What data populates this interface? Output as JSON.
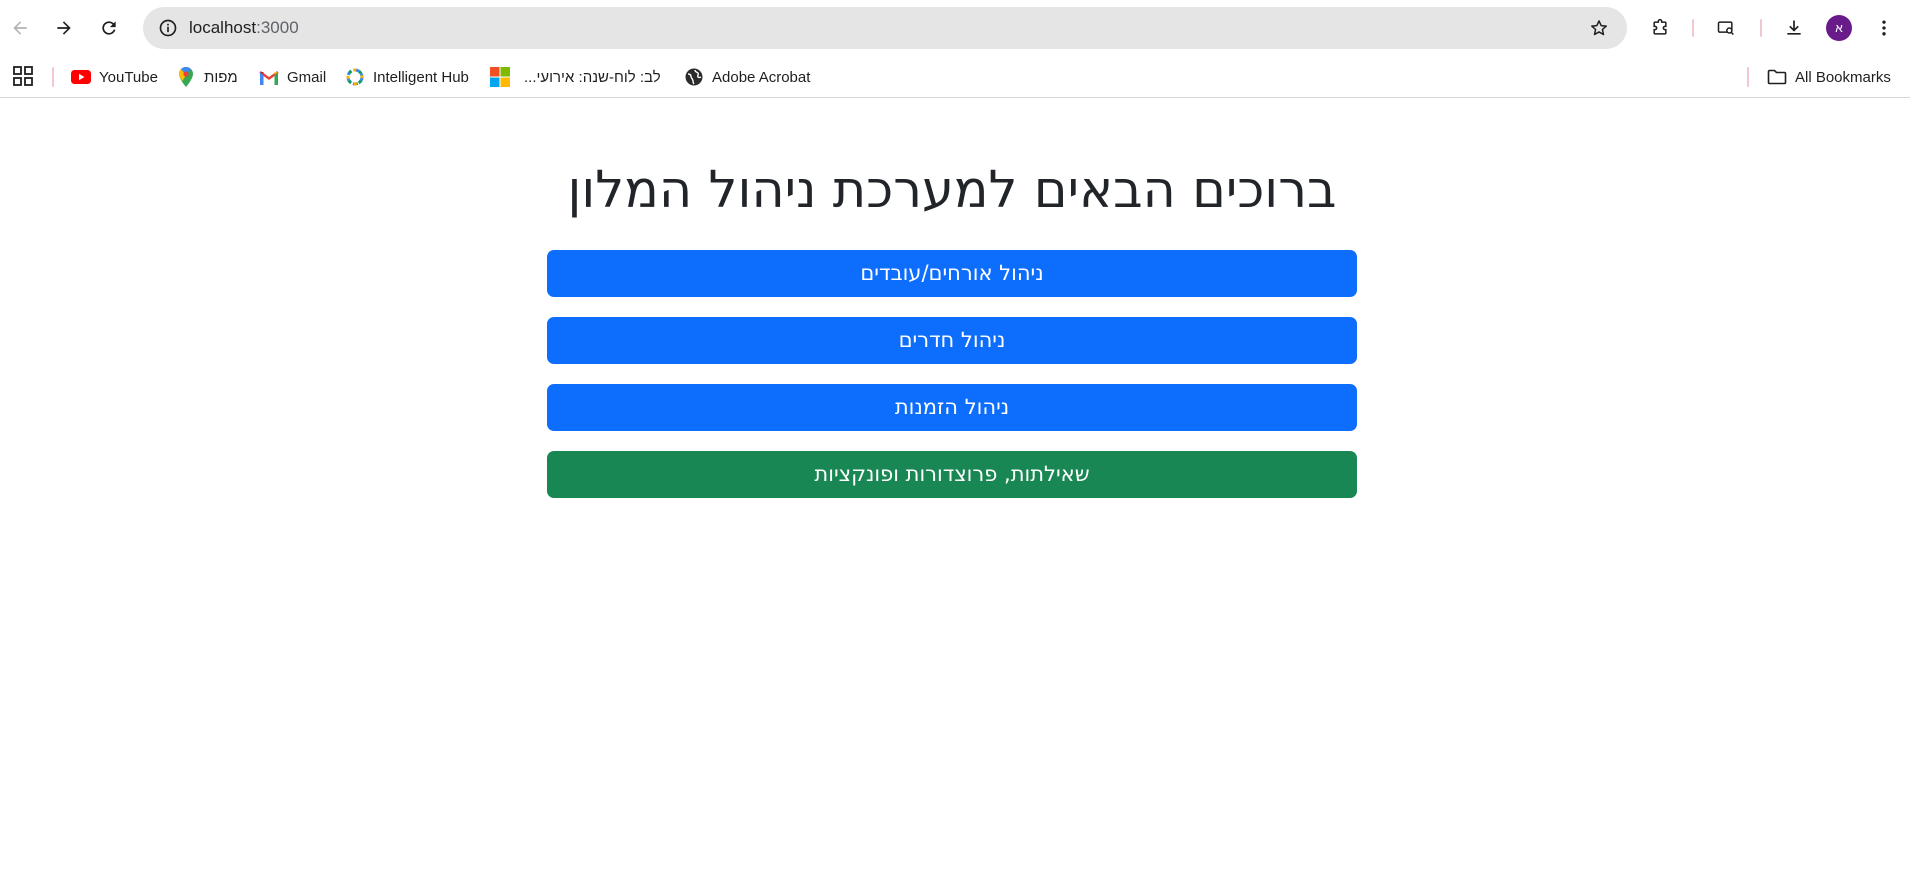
{
  "browser": {
    "url_host": "localhost",
    "url_port": ":3000",
    "profile_initial": "א",
    "icons": {
      "back": "arrow-left-icon",
      "forward": "arrow-right-icon",
      "reload": "reload-icon",
      "site_info": "info-icon",
      "bookmark_star": "star-icon",
      "extensions": "puzzle-icon",
      "media": "media-search-icon",
      "downloads": "download-icon",
      "menu": "kebab-menu-icon"
    }
  },
  "bookmarks": {
    "items": [
      {
        "label": "YouTube",
        "icon": "youtube-icon"
      },
      {
        "label": "מפות",
        "icon": "maps-pin-icon"
      },
      {
        "label": "Gmail",
        "icon": "gmail-icon"
      },
      {
        "label": "Intelligent Hub",
        "icon": "hub-icon"
      },
      {
        "label": "לב: לוח-שנה: אירועי...",
        "icon": "microsoft-icon"
      },
      {
        "label": "Adobe Acrobat",
        "icon": "globe-icon"
      }
    ],
    "all_bookmarks": "All Bookmarks"
  },
  "main": {
    "title": "ברוכים הבאים למערכת ניהול המלון",
    "buttons": [
      {
        "label": "ניהול אורחים/עובדים",
        "variant": "primary"
      },
      {
        "label": "ניהול חדרים",
        "variant": "primary"
      },
      {
        "label": "ניהול הזמנות",
        "variant": "primary"
      },
      {
        "label": "שאילתות, פרוצדורות ופונקציות",
        "variant": "success"
      }
    ]
  },
  "colors": {
    "primary": "#0d6efd",
    "success": "#198754",
    "title_text": "#212529",
    "avatar": "#6a1b8a"
  }
}
